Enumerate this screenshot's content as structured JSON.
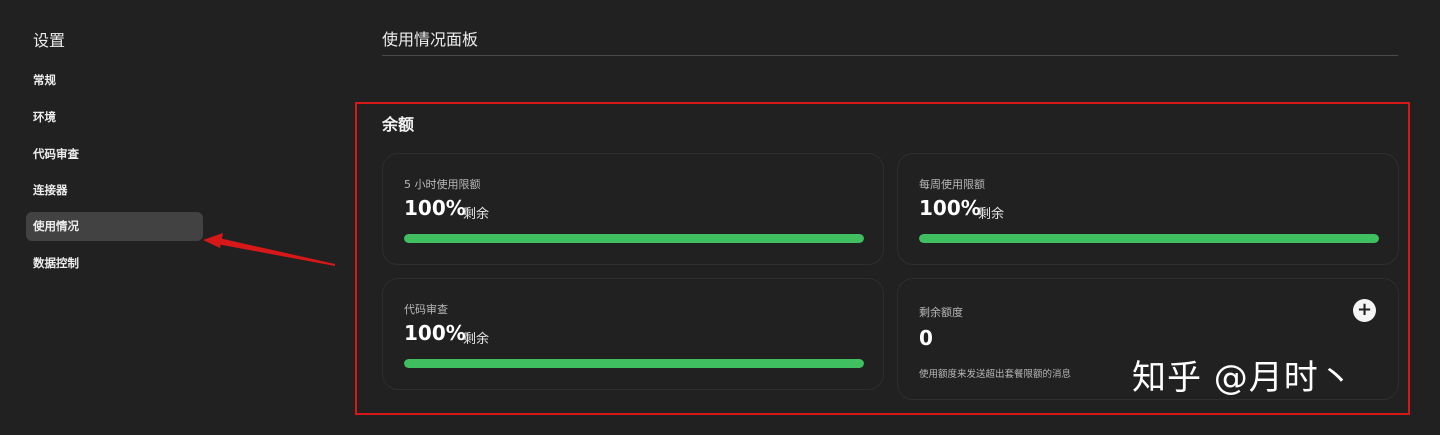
{
  "sidebar": {
    "title": "设置",
    "items": [
      {
        "label": "常规"
      },
      {
        "label": "环境"
      },
      {
        "label": "代码审查"
      },
      {
        "label": "连接器"
      },
      {
        "label": "使用情况"
      },
      {
        "label": "数据控制"
      }
    ],
    "active_index": 4
  },
  "main": {
    "title": "使用情况面板",
    "section_title": "余额",
    "cards": [
      {
        "label": "5 小时使用限额",
        "value": "100%",
        "unit": "剩余",
        "progress_percent": 100
      },
      {
        "label": "每周使用限额",
        "value": "100%",
        "unit": "剩余",
        "progress_percent": 100
      },
      {
        "label": "代码审查",
        "value": "100%",
        "unit": "剩余",
        "progress_percent": 100
      },
      {
        "label": "剩余额度",
        "value": "0",
        "note": "使用额度来发送超出套餐限额的消息",
        "add_icon": "plus-icon"
      }
    ]
  },
  "annotation": {
    "box_color": "#d61818",
    "arrow_color": "#d61818"
  },
  "watermark": "知乎 @月时丶",
  "colors": {
    "background": "#212121",
    "progress": "#3fbf5f",
    "active_nav": "#424242"
  }
}
